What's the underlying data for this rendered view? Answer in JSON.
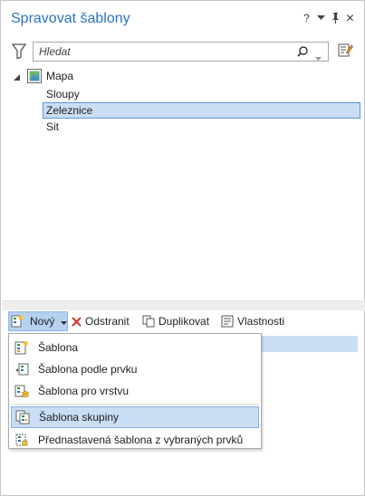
{
  "panel": {
    "title": "Spravovat šablony",
    "controls": [
      "help-icon",
      "dropdown-icon",
      "pin-icon",
      "close-icon"
    ],
    "help_glyph": "?",
    "close_glyph": "✕"
  },
  "search": {
    "placeholder": "Hledat",
    "value": ""
  },
  "tree": {
    "root": {
      "label": "Mapa",
      "icon": "map-icon",
      "expanded": true
    },
    "items": [
      {
        "label": "Sloupy",
        "selected": false
      },
      {
        "label": "Zeleznice",
        "selected": true
      },
      {
        "label": "Sit",
        "selected": false
      }
    ]
  },
  "toolbar": {
    "new_label": "Nový",
    "delete_label": "Odstranit",
    "duplicate_label": "Duplikovat",
    "properties_label": "Vlastnosti"
  },
  "menu": {
    "items": [
      {
        "label": "Šablona",
        "icon": "template-icon",
        "highlighted": false
      },
      {
        "label": "Šablona podle prvku",
        "icon": "template-from-feature-icon",
        "highlighted": false
      },
      {
        "label": "Šablona pro vrstvu",
        "icon": "template-for-layer-icon",
        "highlighted": false
      },
      {
        "label": "Šablona skupiny",
        "icon": "group-template-icon",
        "highlighted": true
      },
      {
        "label": "Přednastavená šablona z vybraných prvků",
        "icon": "preset-template-icon",
        "highlighted": false
      }
    ]
  },
  "colors": {
    "accent": "#2b72c3",
    "selection": "#c9def5",
    "selection_border": "#5e97d6"
  }
}
